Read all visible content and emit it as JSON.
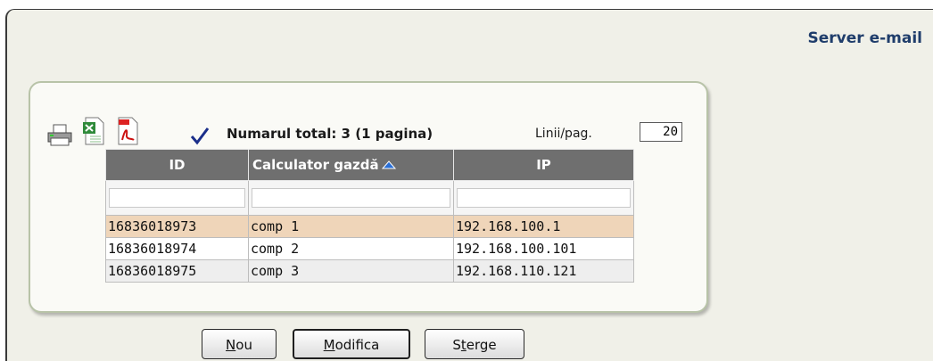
{
  "page": {
    "title": "Server e-mail"
  },
  "toolbar": {
    "icons": [
      "printer-icon",
      "excel-icon",
      "pdf-icon",
      "check-icon"
    ],
    "total_text": "Numarul total: 3 (1 pagina)",
    "rows_label": "Linii/pag.",
    "rows_per_page": "20"
  },
  "grid": {
    "columns": [
      {
        "label": "ID"
      },
      {
        "label": "Calculator gazdă",
        "sorted": "asc"
      },
      {
        "label": "IP"
      }
    ],
    "rows": [
      {
        "id": "16836018973",
        "host": "comp 1",
        "ip": "192.168.100.1"
      },
      {
        "id": "16836018974",
        "host": "comp 2",
        "ip": "192.168.100.101"
      },
      {
        "id": "16836018975",
        "host": "comp 3",
        "ip": "192.168.110.121"
      }
    ]
  },
  "buttons": {
    "new": {
      "pre": "",
      "key": "N",
      "post": "ou"
    },
    "modify": {
      "pre": "",
      "key": "M",
      "post": "odifica"
    },
    "delete": {
      "pre": "S",
      "key": "t",
      "post": "erge"
    }
  },
  "colors": {
    "title": "#1f3d6b",
    "header_bg": "#6f6f6f",
    "selected_row": "#efd5b9",
    "panel_border": "#b8c3a8"
  }
}
